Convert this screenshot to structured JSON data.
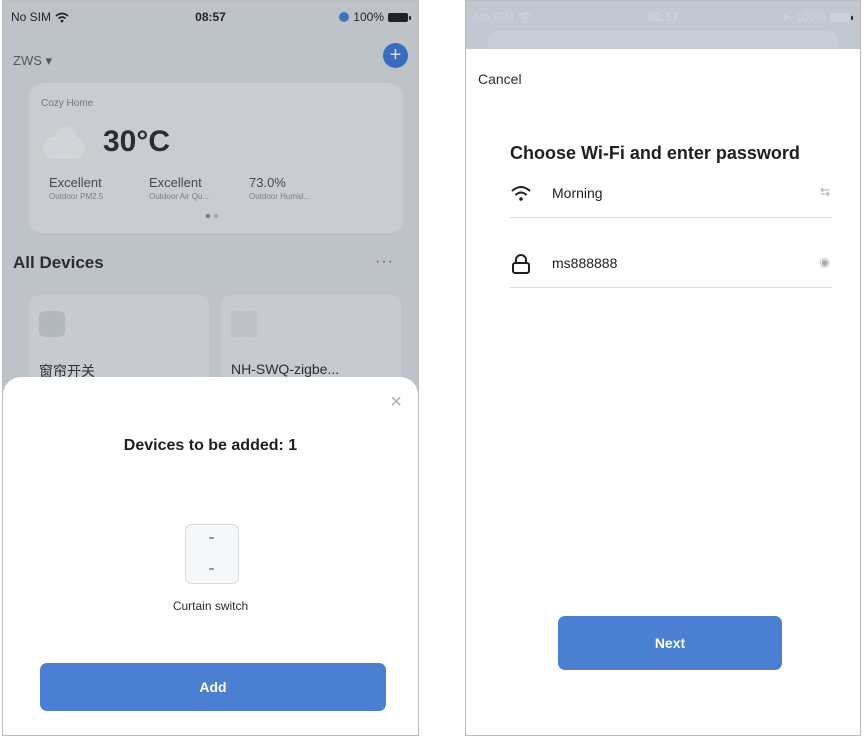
{
  "left_phone": {
    "statusbar": {
      "carrier": "No SIM",
      "time": "08:57",
      "battery": "100%"
    },
    "home": {
      "name": "ZWS",
      "add_icon": "+"
    },
    "weather": {
      "home_label": "Cozy Home",
      "temperature": "30°C",
      "stats": [
        {
          "value": "Excellent",
          "label": "Outdoor PM2.5"
        },
        {
          "value": "Excellent",
          "label": "Outdoor Air Qu..."
        },
        {
          "value": "73.0%",
          "label": "Outdoor Humid..."
        }
      ]
    },
    "devices_section": {
      "title": "All Devices",
      "more": "···"
    },
    "device_cards": [
      {
        "name": "窗帘开关"
      },
      {
        "name": "NH-SWQ-zigbe..."
      }
    ],
    "sheet": {
      "close": "×",
      "title": "Devices to be added: 1",
      "device_name": "Curtain switch",
      "add_label": "Add"
    }
  },
  "right_phone": {
    "statusbar": {
      "carrier": "No SIM",
      "time": "08:57",
      "battery": "100%"
    },
    "cancel_label": "Cancel",
    "title": "Choose Wi-Fi and enter password",
    "wifi_name": "Morning",
    "password": "ms888888",
    "next_label": "Next"
  }
}
